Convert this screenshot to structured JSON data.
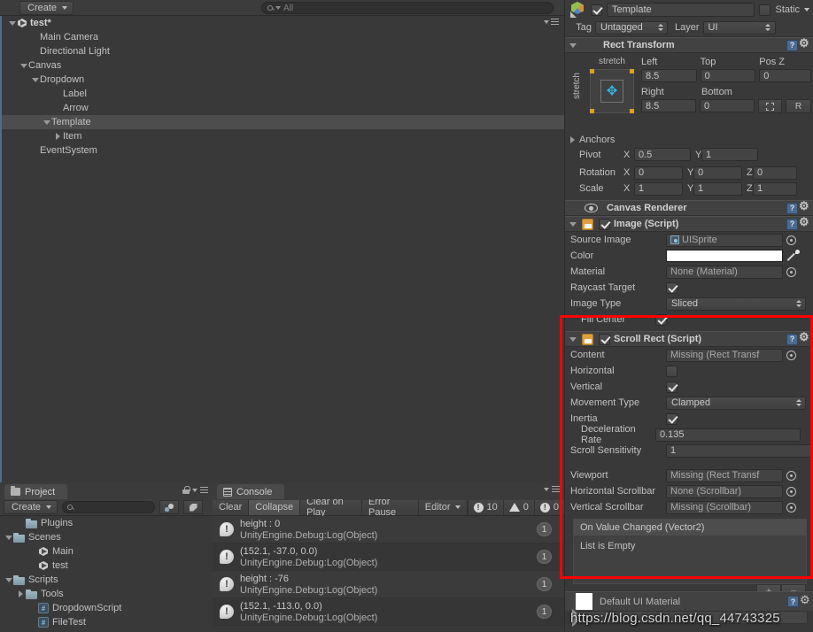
{
  "hierarchy": {
    "create_label": "Create",
    "search_placeholder": "All",
    "items": [
      {
        "label": "test*",
        "indent": 0,
        "arrow": "down",
        "icon": "unity-scene-icon",
        "selected": false,
        "root": true
      },
      {
        "label": "Main Camera",
        "indent": 2,
        "arrow": "none",
        "icon": "none",
        "selected": false,
        "root": false
      },
      {
        "label": "Directional Light",
        "indent": 2,
        "arrow": "none",
        "icon": "none",
        "selected": false,
        "root": false
      },
      {
        "label": "Canvas",
        "indent": 1,
        "arrow": "down",
        "icon": "none",
        "selected": false,
        "root": false
      },
      {
        "label": "Dropdown",
        "indent": 2,
        "arrow": "down",
        "icon": "none",
        "selected": false,
        "root": false
      },
      {
        "label": "Label",
        "indent": 4,
        "arrow": "none",
        "icon": "none",
        "selected": false,
        "root": false
      },
      {
        "label": "Arrow",
        "indent": 4,
        "arrow": "none",
        "icon": "none",
        "selected": false,
        "root": false
      },
      {
        "label": "Template",
        "indent": 3,
        "arrow": "down",
        "icon": "none",
        "selected": true,
        "root": false
      },
      {
        "label": "Item",
        "indent": 4,
        "arrow": "right",
        "icon": "none",
        "selected": false,
        "root": false
      },
      {
        "label": "EventSystem",
        "indent": 2,
        "arrow": "none",
        "icon": "none",
        "selected": false,
        "root": false
      }
    ]
  },
  "project": {
    "tab_label": "Project",
    "create_label": "Create",
    "search_value": "",
    "items": [
      {
        "label": "Plugins",
        "indent": 1,
        "arrow": "none",
        "icon": "folder"
      },
      {
        "label": "Scenes",
        "indent": 0,
        "arrow": "down",
        "icon": "folder"
      },
      {
        "label": "Main",
        "indent": 2,
        "arrow": "none",
        "icon": "unity"
      },
      {
        "label": "test",
        "indent": 2,
        "arrow": "none",
        "icon": "unity"
      },
      {
        "label": "Scripts",
        "indent": 0,
        "arrow": "down",
        "icon": "folder"
      },
      {
        "label": "Tools",
        "indent": 1,
        "arrow": "right",
        "icon": "folder"
      },
      {
        "label": "DropdownScript",
        "indent": 2,
        "arrow": "none",
        "icon": "cs"
      },
      {
        "label": "FileTest",
        "indent": 2,
        "arrow": "none",
        "icon": "cs"
      }
    ]
  },
  "console": {
    "tab_label": "Console",
    "buttons": [
      {
        "label": "Clear",
        "active": false,
        "dropdown": false
      },
      {
        "label": "Collapse",
        "active": true,
        "dropdown": false
      },
      {
        "label": "Clear on Play",
        "active": false,
        "dropdown": false
      },
      {
        "label": "Error Pause",
        "active": false,
        "dropdown": false
      },
      {
        "label": "Editor",
        "active": false,
        "dropdown": true
      }
    ],
    "badges": [
      {
        "icon": "info-icon",
        "count": "10"
      },
      {
        "icon": "warn-icon",
        "count": "0"
      },
      {
        "icon": "error-icon",
        "count": "0"
      }
    ],
    "logs": [
      {
        "line1": "height : 0",
        "line2": "UnityEngine.Debug:Log(Object)",
        "count": "1"
      },
      {
        "line1": "(152.1, -37.0, 0.0)",
        "line2": "UnityEngine.Debug:Log(Object)",
        "count": "1"
      },
      {
        "line1": "height : -76",
        "line2": "UnityEngine.Debug:Log(Object)",
        "count": "1"
      },
      {
        "line1": "(152.1, -113.0, 0.0)",
        "line2": "UnityEngine.Debug:Log(Object)",
        "count": "1"
      }
    ]
  },
  "inspector": {
    "object_name": "Template",
    "enabled": true,
    "static_label": "Static",
    "tag_label": "Tag",
    "tag_value": "Untagged",
    "layer_label": "Layer",
    "layer_value": "UI",
    "rect_transform": {
      "title": "Rect Transform",
      "anchor_preset_top": "stretch",
      "anchor_preset_left": "stretch",
      "fields": [
        {
          "label": "Left",
          "value": "8.5"
        },
        {
          "label": "Top",
          "value": "0"
        },
        {
          "label": "Pos Z",
          "value": "0"
        },
        {
          "label": "Right",
          "value": "8.5"
        },
        {
          "label": "Bottom",
          "value": "0"
        }
      ],
      "blueprint_label": "",
      "raw_label": "R",
      "anchors_label": "Anchors",
      "pivot_label": "Pivot",
      "pivot_x": "0.5",
      "pivot_y": "1",
      "rotation_label": "Rotation",
      "rotation_x": "0",
      "rotation_y": "0",
      "rotation_z": "0",
      "scale_label": "Scale",
      "scale_x": "1",
      "scale_y": "1",
      "scale_z": "1",
      "axis_x": "X",
      "axis_y": "Y",
      "axis_z": "Z"
    },
    "canvas_renderer": {
      "title": "Canvas Renderer"
    },
    "image_script": {
      "title": "Image (Script)",
      "enabled": true,
      "rows": [
        {
          "label": "Source Image",
          "value": "UISprite",
          "type": "object"
        },
        {
          "label": "Color",
          "value": "#FFFFFF",
          "type": "color"
        },
        {
          "label": "Material",
          "value": "None (Material)",
          "type": "object"
        },
        {
          "label": "Raycast Target",
          "value": "",
          "type": "checkbox",
          "checked": true
        },
        {
          "label": "Image Type",
          "value": "Sliced",
          "type": "dropdown"
        },
        {
          "label": "Fill Center",
          "value": "",
          "type": "checkbox",
          "checked": true,
          "indent": true
        }
      ]
    },
    "scroll_rect": {
      "title": "Scroll Rect (Script)",
      "enabled": true,
      "rows": [
        {
          "label": "Content",
          "value": "Missing (Rect Transf",
          "type": "object"
        },
        {
          "label": "Horizontal",
          "value": "",
          "type": "checkbox",
          "checked": false
        },
        {
          "label": "Vertical",
          "value": "",
          "type": "checkbox",
          "checked": true
        },
        {
          "label": "Movement Type",
          "value": "Clamped",
          "type": "dropdown"
        },
        {
          "label": "Inertia",
          "value": "",
          "type": "checkbox",
          "checked": true
        },
        {
          "label": "Deceleration Rate",
          "value": "0.135",
          "type": "number",
          "indent": true
        },
        {
          "label": "Scroll Sensitivity",
          "value": "1",
          "type": "number"
        },
        {
          "label": "",
          "value": "",
          "type": "spacer"
        },
        {
          "label": "Viewport",
          "value": "Missing (Rect Transf",
          "type": "object"
        },
        {
          "label": "Horizontal Scrollbar",
          "value": "None (Scrollbar)",
          "type": "object"
        },
        {
          "label": "Vertical Scrollbar",
          "value": "Missing (Scrollbar)",
          "type": "object"
        }
      ],
      "event_title": "On Value Changed (Vector2)",
      "event_empty": "List is Empty",
      "add_label": "+",
      "remove_label": "−"
    },
    "material_footer": {
      "title": "Default UI Material"
    }
  },
  "watermark": "https://blog.csdn.net/qq_44743325",
  "colors": {
    "accent_red": "#ff0000",
    "panel_bg": "#393939",
    "header_bg": "#424242",
    "selection": "#4d4d4d"
  }
}
